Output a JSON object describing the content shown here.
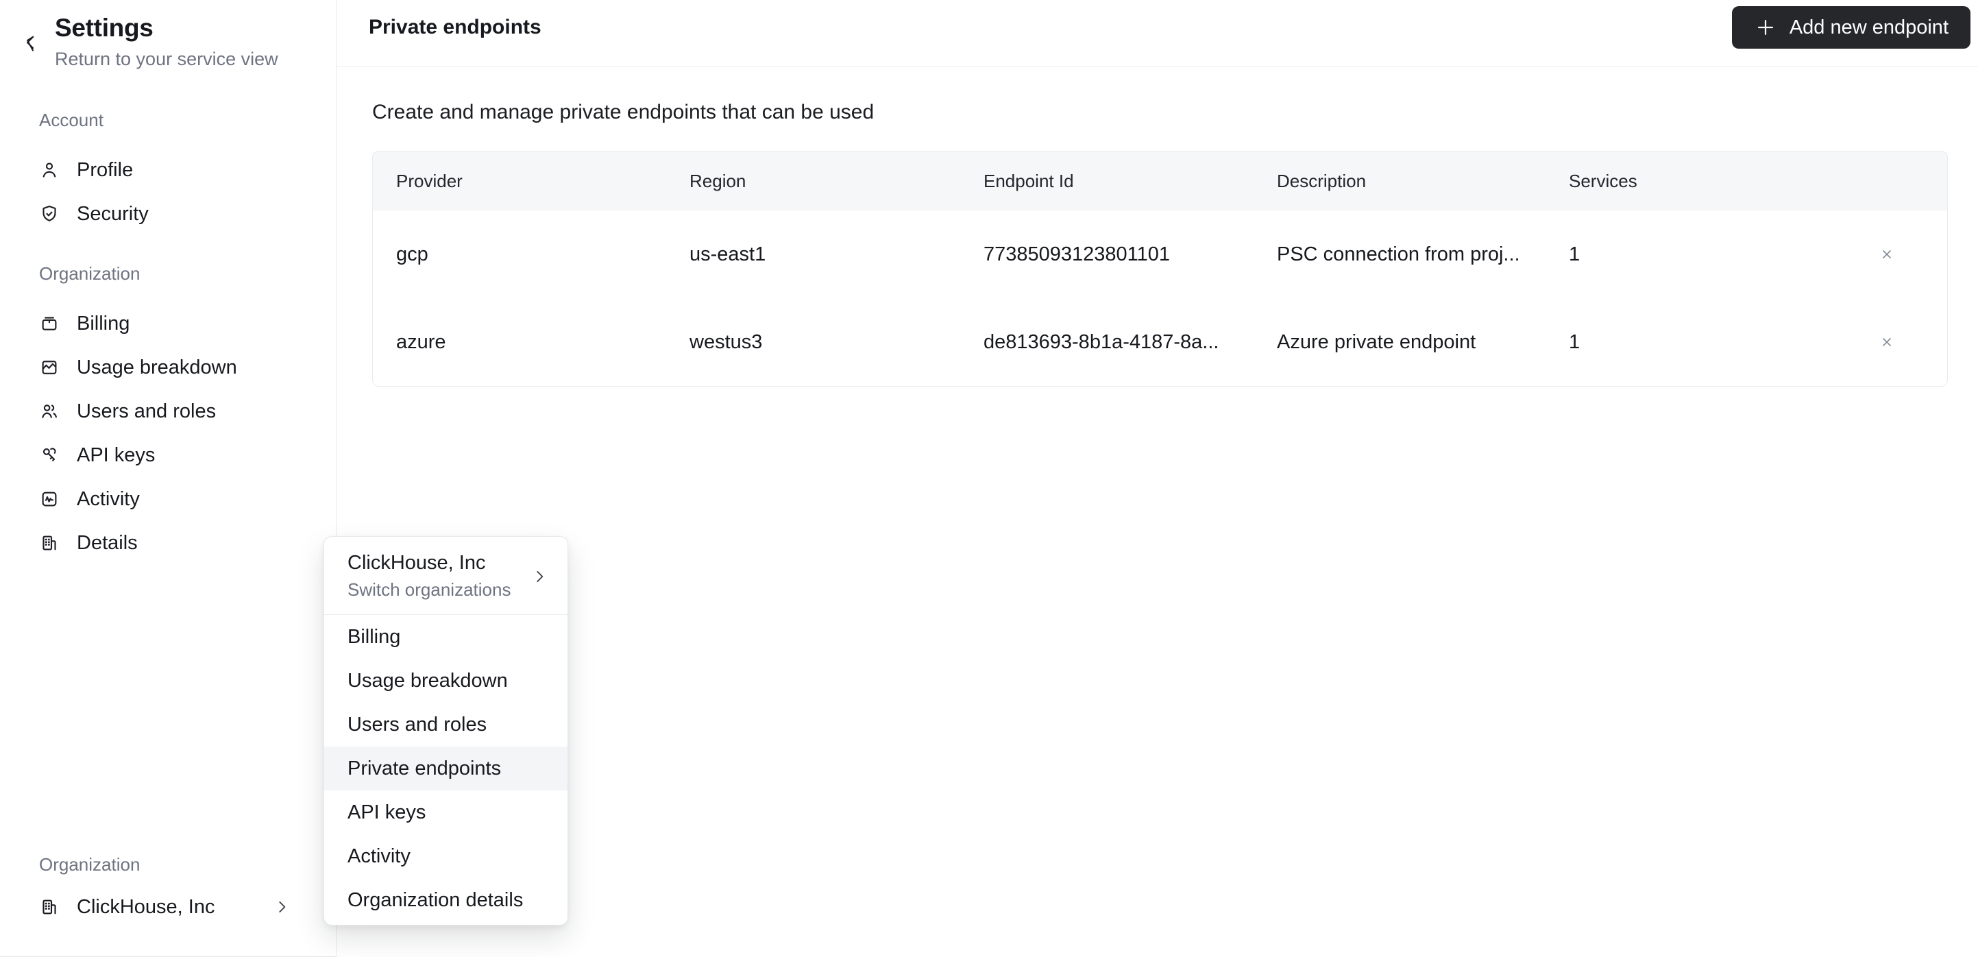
{
  "sidebar": {
    "title": "Settings",
    "subtitle": "Return to your service view",
    "sections": [
      {
        "label": "Account",
        "items": [
          {
            "label": "Profile",
            "icon": "user-icon"
          },
          {
            "label": "Security",
            "icon": "shield-check-icon"
          }
        ]
      },
      {
        "label": "Organization",
        "items": [
          {
            "label": "Billing",
            "icon": "wallet-icon"
          },
          {
            "label": "Usage breakdown",
            "icon": "chart-image-icon"
          },
          {
            "label": "Users and roles",
            "icon": "users-icon"
          },
          {
            "label": "API keys",
            "icon": "keys-icon"
          },
          {
            "label": "Activity",
            "icon": "activity-icon"
          },
          {
            "label": "Details",
            "icon": "building-icon"
          }
        ]
      }
    ],
    "footer": {
      "label": "Organization",
      "org_name": "ClickHouse, Inc",
      "org_icon": "building-icon",
      "chevron_icon": "chevron-right-icon"
    }
  },
  "header": {
    "title": "Private endpoints",
    "add_button": {
      "label": "Add new endpoint",
      "icon": "plus-icon"
    }
  },
  "content": {
    "description": "Create and manage private endpoints that can be used",
    "table": {
      "columns": [
        "Provider",
        "Region",
        "Endpoint Id",
        "Description",
        "Services"
      ],
      "rows": [
        {
          "provider": "gcp",
          "region": "us-east1",
          "endpoint_id": "77385093123801101",
          "description": "PSC connection from proj...",
          "services": "1",
          "remove_icon": "close-icon"
        },
        {
          "provider": "azure",
          "region": "westus3",
          "endpoint_id": "de813693-8b1a-4187-8a...",
          "description": "Azure private endpoint",
          "services": "1",
          "remove_icon": "close-icon"
        }
      ]
    }
  },
  "org_menu": {
    "org_name": "ClickHouse, Inc",
    "org_action": "Switch organizations",
    "chevron_icon": "chevron-right-icon",
    "items": [
      {
        "label": "Billing"
      },
      {
        "label": "Usage breakdown"
      },
      {
        "label": "Users and roles"
      },
      {
        "label": "Private endpoints"
      },
      {
        "label": "API keys"
      },
      {
        "label": "Activity"
      },
      {
        "label": "Organization details"
      }
    ],
    "active_item": "Private endpoints"
  },
  "colors": {
    "accent_button": "#26272b",
    "menu_highlight": "#f4f5f7",
    "table_header_bg": "#f6f7f9",
    "border": "#e8e9ec",
    "text_primary": "#17191e",
    "text_secondary": "#6e7381"
  }
}
